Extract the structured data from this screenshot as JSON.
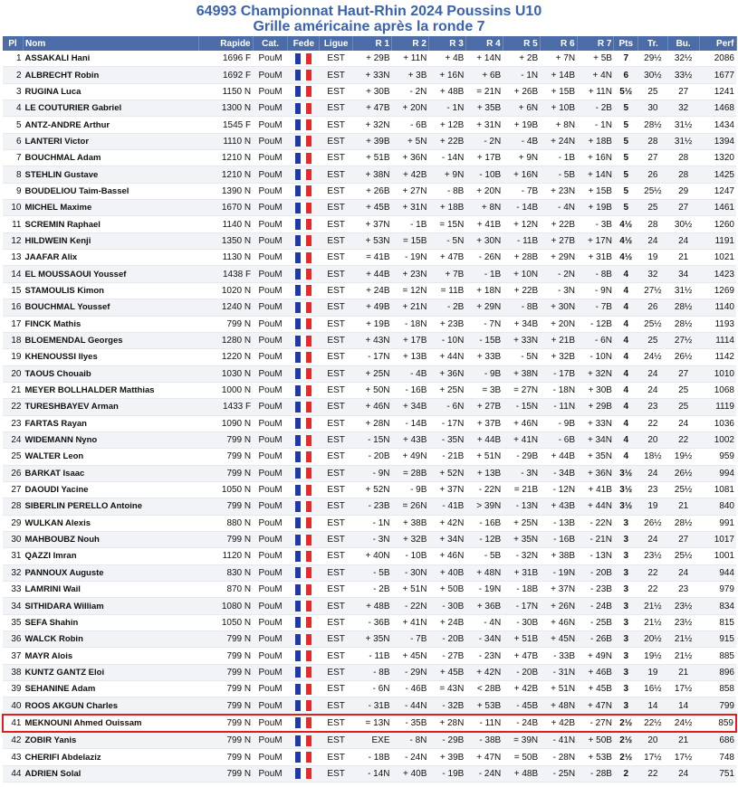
{
  "header": {
    "title": "64993 Championnat Haut-Rhin 2024 Poussins U10",
    "subtitle": "Grille américaine après la ronde 7"
  },
  "columns": [
    "Pl",
    "Nom",
    "Rapide",
    "Cat.",
    "Fede",
    "Ligue",
    "R 1",
    "R 2",
    "R 3",
    "R 4",
    "R 5",
    "R 6",
    "R 7",
    "Pts",
    "Tr.",
    "Bu.",
    "Perf"
  ],
  "highlight_row": 41,
  "colors": {
    "header_bg": "#4b6ca6",
    "title": "#3a62ad",
    "highlight_border": "#e01e1e",
    "flag": [
      "#1f3aa8",
      "#ffffff",
      "#e32b2b"
    ]
  },
  "rows": [
    {
      "pl": "1",
      "nom": "ASSAKALI Hani",
      "rapide": "1696 F",
      "cat": "PouM",
      "fede": "FRA",
      "ligue": "EST",
      "r1": "+ 29B",
      "r2": "+ 11N",
      "r3": "+ 4B",
      "r4": "+ 14N",
      "r5": "+ 2B",
      "r6": "+ 7N",
      "r7": "+ 5B",
      "pts": "7",
      "tr": "29½",
      "bu": "32½",
      "perf": "2086"
    },
    {
      "pl": "2",
      "nom": "ALBRECHT Robin",
      "rapide": "1692 F",
      "cat": "PouM",
      "fede": "FRA",
      "ligue": "EST",
      "r1": "+ 33N",
      "r2": "+ 3B",
      "r3": "+ 16N",
      "r4": "+ 6B",
      "r5": "- 1N",
      "r6": "+ 14B",
      "r7": "+ 4N",
      "pts": "6",
      "tr": "30½",
      "bu": "33½",
      "perf": "1677"
    },
    {
      "pl": "3",
      "nom": "RUGINA Luca",
      "rapide": "1150 N",
      "cat": "PouM",
      "fede": "FRA",
      "ligue": "EST",
      "r1": "+ 30B",
      "r2": "- 2N",
      "r3": "+ 48B",
      "r4": "= 21N",
      "r5": "+ 26B",
      "r6": "+ 15B",
      "r7": "+ 11N",
      "pts": "5½",
      "tr": "25",
      "bu": "27",
      "perf": "1241"
    },
    {
      "pl": "4",
      "nom": "LE COUTURIER Gabriel",
      "rapide": "1300 N",
      "cat": "PouM",
      "fede": "FRA",
      "ligue": "EST",
      "r1": "+ 47B",
      "r2": "+ 20N",
      "r3": "- 1N",
      "r4": "+ 35B",
      "r5": "+ 6N",
      "r6": "+ 10B",
      "r7": "- 2B",
      "pts": "5",
      "tr": "30",
      "bu": "32",
      "perf": "1468"
    },
    {
      "pl": "5",
      "nom": "ANTZ-ANDRE Arthur",
      "rapide": "1545 F",
      "cat": "PouM",
      "fede": "FRA",
      "ligue": "EST",
      "r1": "+ 32N",
      "r2": "- 6B",
      "r3": "+ 12B",
      "r4": "+ 31N",
      "r5": "+ 19B",
      "r6": "+ 8N",
      "r7": "- 1N",
      "pts": "5",
      "tr": "28½",
      "bu": "31½",
      "perf": "1434"
    },
    {
      "pl": "6",
      "nom": "LANTERI Victor",
      "rapide": "1110 N",
      "cat": "PouM",
      "fede": "FRA",
      "ligue": "EST",
      "r1": "+ 39B",
      "r2": "+ 5N",
      "r3": "+ 22B",
      "r4": "- 2N",
      "r5": "- 4B",
      "r6": "+ 24N",
      "r7": "+ 18B",
      "pts": "5",
      "tr": "28",
      "bu": "31½",
      "perf": "1394"
    },
    {
      "pl": "7",
      "nom": "BOUCHMAL Adam",
      "rapide": "1210 N",
      "cat": "PouM",
      "fede": "FRA",
      "ligue": "EST",
      "r1": "+ 51B",
      "r2": "+ 36N",
      "r3": "- 14N",
      "r4": "+ 17B",
      "r5": "+ 9N",
      "r6": "- 1B",
      "r7": "+ 16N",
      "pts": "5",
      "tr": "27",
      "bu": "28",
      "perf": "1320"
    },
    {
      "pl": "8",
      "nom": "STEHLIN Gustave",
      "rapide": "1210 N",
      "cat": "PouM",
      "fede": "FRA",
      "ligue": "EST",
      "r1": "+ 38N",
      "r2": "+ 42B",
      "r3": "+ 9N",
      "r4": "- 10B",
      "r5": "+ 16N",
      "r6": "- 5B",
      "r7": "+ 14N",
      "pts": "5",
      "tr": "26",
      "bu": "28",
      "perf": "1425"
    },
    {
      "pl": "9",
      "nom": "BOUDELIOU Taim-Bassel",
      "rapide": "1390 N",
      "cat": "PouM",
      "fede": "FRA",
      "ligue": "EST",
      "r1": "+ 26B",
      "r2": "+ 27N",
      "r3": "- 8B",
      "r4": "+ 20N",
      "r5": "- 7B",
      "r6": "+ 23N",
      "r7": "+ 15B",
      "pts": "5",
      "tr": "25½",
      "bu": "29",
      "perf": "1247"
    },
    {
      "pl": "10",
      "nom": "MICHEL Maxime",
      "rapide": "1670 N",
      "cat": "PouM",
      "fede": "FRA",
      "ligue": "EST",
      "r1": "+ 45B",
      "r2": "+ 31N",
      "r3": "+ 18B",
      "r4": "+ 8N",
      "r5": "- 14B",
      "r6": "- 4N",
      "r7": "+ 19B",
      "pts": "5",
      "tr": "25",
      "bu": "27",
      "perf": "1461"
    },
    {
      "pl": "11",
      "nom": "SCREMIN Raphael",
      "rapide": "1140 N",
      "cat": "PouM",
      "fede": "FRA",
      "ligue": "EST",
      "r1": "+ 37N",
      "r2": "- 1B",
      "r3": "= 15N",
      "r4": "+ 41B",
      "r5": "+ 12N",
      "r6": "+ 22B",
      "r7": "- 3B",
      "pts": "4½",
      "tr": "28",
      "bu": "30½",
      "perf": "1260"
    },
    {
      "pl": "12",
      "nom": "HILDWEIN Kenji",
      "rapide": "1350 N",
      "cat": "PouM",
      "fede": "FRA",
      "ligue": "EST",
      "r1": "+ 53N",
      "r2": "= 15B",
      "r3": "- 5N",
      "r4": "+ 30N",
      "r5": "- 11B",
      "r6": "+ 27B",
      "r7": "+ 17N",
      "pts": "4½",
      "tr": "24",
      "bu": "24",
      "perf": "1191"
    },
    {
      "pl": "13",
      "nom": "JAAFAR Alix",
      "rapide": "1130 N",
      "cat": "PouM",
      "fede": "FRA",
      "ligue": "EST",
      "r1": "= 41B",
      "r2": "- 19N",
      "r3": "+ 47B",
      "r4": "- 26N",
      "r5": "+ 28B",
      "r6": "+ 29N",
      "r7": "+ 31B",
      "pts": "4½",
      "tr": "19",
      "bu": "21",
      "perf": "1021"
    },
    {
      "pl": "14",
      "nom": "EL MOUSSAOUI Youssef",
      "rapide": "1438 F",
      "cat": "PouM",
      "fede": "FRA",
      "ligue": "EST",
      "r1": "+ 44B",
      "r2": "+ 23N",
      "r3": "+ 7B",
      "r4": "- 1B",
      "r5": "+ 10N",
      "r6": "- 2N",
      "r7": "- 8B",
      "pts": "4",
      "tr": "32",
      "bu": "34",
      "perf": "1423"
    },
    {
      "pl": "15",
      "nom": "STAMOULIS Kimon",
      "rapide": "1020 N",
      "cat": "PouM",
      "fede": "FRA",
      "ligue": "EST",
      "r1": "+ 24B",
      "r2": "= 12N",
      "r3": "= 11B",
      "r4": "+ 18N",
      "r5": "+ 22B",
      "r6": "- 3N",
      "r7": "- 9N",
      "pts": "4",
      "tr": "27½",
      "bu": "31½",
      "perf": "1269"
    },
    {
      "pl": "16",
      "nom": "BOUCHMAL Youssef",
      "rapide": "1240 N",
      "cat": "PouM",
      "fede": "FRA",
      "ligue": "EST",
      "r1": "+ 49B",
      "r2": "+ 21N",
      "r3": "- 2B",
      "r4": "+ 29N",
      "r5": "- 8B",
      "r6": "+ 30N",
      "r7": "- 7B",
      "pts": "4",
      "tr": "26",
      "bu": "28½",
      "perf": "1140"
    },
    {
      "pl": "17",
      "nom": "FINCK Mathis",
      "rapide": "799 N",
      "cat": "PouM",
      "fede": "FRA",
      "ligue": "EST",
      "r1": "+ 19B",
      "r2": "- 18N",
      "r3": "+ 23B",
      "r4": "- 7N",
      "r5": "+ 34B",
      "r6": "+ 20N",
      "r7": "- 12B",
      "pts": "4",
      "tr": "25½",
      "bu": "28½",
      "perf": "1193"
    },
    {
      "pl": "18",
      "nom": "BLOEMENDAL Georges",
      "rapide": "1280 N",
      "cat": "PouM",
      "fede": "FRA",
      "ligue": "EST",
      "r1": "+ 43N",
      "r2": "+ 17B",
      "r3": "- 10N",
      "r4": "- 15B",
      "r5": "+ 33N",
      "r6": "+ 21B",
      "r7": "- 6N",
      "pts": "4",
      "tr": "25",
      "bu": "27½",
      "perf": "1114"
    },
    {
      "pl": "19",
      "nom": "KHENOUSSI Ilyes",
      "rapide": "1220 N",
      "cat": "PouM",
      "fede": "FRA",
      "ligue": "EST",
      "r1": "- 17N",
      "r2": "+ 13B",
      "r3": "+ 44N",
      "r4": "+ 33B",
      "r5": "- 5N",
      "r6": "+ 32B",
      "r7": "- 10N",
      "pts": "4",
      "tr": "24½",
      "bu": "26½",
      "perf": "1142"
    },
    {
      "pl": "20",
      "nom": "TAOUS Chouaib",
      "rapide": "1030 N",
      "cat": "PouM",
      "fede": "FRA",
      "ligue": "EST",
      "r1": "+ 25N",
      "r2": "- 4B",
      "r3": "+ 36N",
      "r4": "- 9B",
      "r5": "+ 38N",
      "r6": "- 17B",
      "r7": "+ 32N",
      "pts": "4",
      "tr": "24",
      "bu": "27",
      "perf": "1010"
    },
    {
      "pl": "21",
      "nom": "MEYER BOLLHALDER Matthias",
      "rapide": "1000 N",
      "cat": "PouM",
      "fede": "FRA",
      "ligue": "EST",
      "r1": "+ 50N",
      "r2": "- 16B",
      "r3": "+ 25N",
      "r4": "= 3B",
      "r5": "= 27N",
      "r6": "- 18N",
      "r7": "+ 30B",
      "pts": "4",
      "tr": "24",
      "bu": "25",
      "perf": "1068"
    },
    {
      "pl": "22",
      "nom": "TURESHBAYEV Arman",
      "rapide": "1433 F",
      "cat": "PouM",
      "fede": "FRA",
      "ligue": "EST",
      "r1": "+ 46N",
      "r2": "+ 34B",
      "r3": "- 6N",
      "r4": "+ 27B",
      "r5": "- 15N",
      "r6": "- 11N",
      "r7": "+ 29B",
      "pts": "4",
      "tr": "23",
      "bu": "25",
      "perf": "1119"
    },
    {
      "pl": "23",
      "nom": "FARTAS Rayan",
      "rapide": "1090 N",
      "cat": "PouM",
      "fede": "FRA",
      "ligue": "EST",
      "r1": "+ 28N",
      "r2": "- 14B",
      "r3": "- 17N",
      "r4": "+ 37B",
      "r5": "+ 46N",
      "r6": "- 9B",
      "r7": "+ 33N",
      "pts": "4",
      "tr": "22",
      "bu": "24",
      "perf": "1036"
    },
    {
      "pl": "24",
      "nom": "WIDEMANN Nyno",
      "rapide": "799 N",
      "cat": "PouM",
      "fede": "FRA",
      "ligue": "EST",
      "r1": "- 15N",
      "r2": "+ 43B",
      "r3": "- 35N",
      "r4": "+ 44B",
      "r5": "+ 41N",
      "r6": "- 6B",
      "r7": "+ 34N",
      "pts": "4",
      "tr": "20",
      "bu": "22",
      "perf": "1002"
    },
    {
      "pl": "25",
      "nom": "WALTER Leon",
      "rapide": "799 N",
      "cat": "PouM",
      "fede": "FRA",
      "ligue": "EST",
      "r1": "- 20B",
      "r2": "+ 49N",
      "r3": "- 21B",
      "r4": "+ 51N",
      "r5": "- 29B",
      "r6": "+ 44B",
      "r7": "+ 35N",
      "pts": "4",
      "tr": "18½",
      "bu": "19½",
      "perf": "959"
    },
    {
      "pl": "26",
      "nom": "BARKAT Isaac",
      "rapide": "799 N",
      "cat": "PouM",
      "fede": "FRA",
      "ligue": "EST",
      "r1": "- 9N",
      "r2": "= 28B",
      "r3": "+ 52N",
      "r4": "+ 13B",
      "r5": "- 3N",
      "r6": "- 34B",
      "r7": "+ 36N",
      "pts": "3½",
      "tr": "24",
      "bu": "26½",
      "perf": "994"
    },
    {
      "pl": "27",
      "nom": "DAOUDI Yacine",
      "rapide": "1050 N",
      "cat": "PouM",
      "fede": "FRA",
      "ligue": "EST",
      "r1": "+ 52N",
      "r2": "- 9B",
      "r3": "+ 37N",
      "r4": "- 22N",
      "r5": "= 21B",
      "r6": "- 12N",
      "r7": "+ 41B",
      "pts": "3½",
      "tr": "23",
      "bu": "25½",
      "perf": "1081"
    },
    {
      "pl": "28",
      "nom": "SIBERLIN PERELLO Antoine",
      "rapide": "799 N",
      "cat": "PouM",
      "fede": "FRA",
      "ligue": "EST",
      "r1": "- 23B",
      "r2": "= 26N",
      "r3": "- 41B",
      "r4": "> 39N",
      "r5": "- 13N",
      "r6": "+ 43B",
      "r7": "+ 44N",
      "pts": "3½",
      "tr": "19",
      "bu": "21",
      "perf": "840"
    },
    {
      "pl": "29",
      "nom": "WULKAN Alexis",
      "rapide": "880 N",
      "cat": "PouM",
      "fede": "FRA",
      "ligue": "EST",
      "r1": "- 1N",
      "r2": "+ 38B",
      "r3": "+ 42N",
      "r4": "- 16B",
      "r5": "+ 25N",
      "r6": "- 13B",
      "r7": "- 22N",
      "pts": "3",
      "tr": "26½",
      "bu": "28½",
      "perf": "991"
    },
    {
      "pl": "30",
      "nom": "MAHBOUBZ Nouh",
      "rapide": "799 N",
      "cat": "PouM",
      "fede": "FRA",
      "ligue": "EST",
      "r1": "- 3N",
      "r2": "+ 32B",
      "r3": "+ 34N",
      "r4": "- 12B",
      "r5": "+ 35N",
      "r6": "- 16B",
      "r7": "- 21N",
      "pts": "3",
      "tr": "24",
      "bu": "27",
      "perf": "1017"
    },
    {
      "pl": "31",
      "nom": "QAZZI Imran",
      "rapide": "1120 N",
      "cat": "PouM",
      "fede": "FRA",
      "ligue": "EST",
      "r1": "+ 40N",
      "r2": "- 10B",
      "r3": "+ 46N",
      "r4": "- 5B",
      "r5": "- 32N",
      "r6": "+ 38B",
      "r7": "- 13N",
      "pts": "3",
      "tr": "23½",
      "bu": "25½",
      "perf": "1001"
    },
    {
      "pl": "32",
      "nom": "PANNOUX Auguste",
      "rapide": "830 N",
      "cat": "PouM",
      "fede": "FRA",
      "ligue": "EST",
      "r1": "- 5B",
      "r2": "- 30N",
      "r3": "+ 40B",
      "r4": "+ 48N",
      "r5": "+ 31B",
      "r6": "- 19N",
      "r7": "- 20B",
      "pts": "3",
      "tr": "22",
      "bu": "24",
      "perf": "944"
    },
    {
      "pl": "33",
      "nom": "LAMRINI Wail",
      "rapide": "870 N",
      "cat": "PouM",
      "fede": "FRA",
      "ligue": "EST",
      "r1": "- 2B",
      "r2": "+ 51N",
      "r3": "+ 50B",
      "r4": "- 19N",
      "r5": "- 18B",
      "r6": "+ 37N",
      "r7": "- 23B",
      "pts": "3",
      "tr": "22",
      "bu": "23",
      "perf": "979"
    },
    {
      "pl": "34",
      "nom": "SITHIDARA William",
      "rapide": "1080 N",
      "cat": "PouM",
      "fede": "FRA",
      "ligue": "EST",
      "r1": "+ 48B",
      "r2": "- 22N",
      "r3": "- 30B",
      "r4": "+ 36B",
      "r5": "- 17N",
      "r6": "+ 26N",
      "r7": "- 24B",
      "pts": "3",
      "tr": "21½",
      "bu": "23½",
      "perf": "834"
    },
    {
      "pl": "35",
      "nom": "SEFA Shahin",
      "rapide": "1050 N",
      "cat": "PouM",
      "fede": "FRA",
      "ligue": "EST",
      "r1": "- 36B",
      "r2": "+ 41N",
      "r3": "+ 24B",
      "r4": "- 4N",
      "r5": "- 30B",
      "r6": "+ 46N",
      "r7": "- 25B",
      "pts": "3",
      "tr": "21½",
      "bu": "23½",
      "perf": "815"
    },
    {
      "pl": "36",
      "nom": "WALCK Robin",
      "rapide": "799 N",
      "cat": "PouM",
      "fede": "FRA",
      "ligue": "EST",
      "r1": "+ 35N",
      "r2": "- 7B",
      "r3": "- 20B",
      "r4": "- 34N",
      "r5": "+ 51B",
      "r6": "+ 45N",
      "r7": "- 26B",
      "pts": "3",
      "tr": "20½",
      "bu": "21½",
      "perf": "915"
    },
    {
      "pl": "37",
      "nom": "MAYR Alois",
      "rapide": "799 N",
      "cat": "PouM",
      "fede": "FRA",
      "ligue": "EST",
      "r1": "- 11B",
      "r2": "+ 45N",
      "r3": "- 27B",
      "r4": "- 23N",
      "r5": "+ 47B",
      "r6": "- 33B",
      "r7": "+ 49N",
      "pts": "3",
      "tr": "19½",
      "bu": "21½",
      "perf": "885"
    },
    {
      "pl": "38",
      "nom": "KUNTZ GANTZ Eloi",
      "rapide": "799 N",
      "cat": "PouM",
      "fede": "FRA",
      "ligue": "EST",
      "r1": "- 8B",
      "r2": "- 29N",
      "r3": "+ 45B",
      "r4": "+ 42N",
      "r5": "- 20B",
      "r6": "- 31N",
      "r7": "+ 46B",
      "pts": "3",
      "tr": "19",
      "bu": "21",
      "perf": "896"
    },
    {
      "pl": "39",
      "nom": "SEHANINE Adam",
      "rapide": "799 N",
      "cat": "PouM",
      "fede": "FRA",
      "ligue": "EST",
      "r1": "- 6N",
      "r2": "- 46B",
      "r3": "= 43N",
      "r4": "< 28B",
      "r5": "+ 42B",
      "r6": "+ 51N",
      "r7": "+ 45B",
      "pts": "3",
      "tr": "16½",
      "bu": "17½",
      "perf": "858"
    },
    {
      "pl": "40",
      "nom": "ROOS AKGUN Charles",
      "rapide": "799 N",
      "cat": "PouM",
      "fede": "FRA",
      "ligue": "EST",
      "r1": "- 31B",
      "r2": "- 44N",
      "r3": "- 32B",
      "r4": "+ 53B",
      "r5": "- 45B",
      "r6": "+ 48N",
      "r7": "+ 47N",
      "pts": "3",
      "tr": "14",
      "bu": "14",
      "perf": "799"
    },
    {
      "pl": "41",
      "nom": "MEKNOUNI Ahmed Ouissam",
      "rapide": "799 N",
      "cat": "PouM",
      "fede": "FRA",
      "ligue": "EST",
      "r1": "= 13N",
      "r2": "- 35B",
      "r3": "+ 28N",
      "r4": "- 11N",
      "r5": "- 24B",
      "r6": "+ 42B",
      "r7": "- 27N",
      "pts": "2½",
      "tr": "22½",
      "bu": "24½",
      "perf": "859"
    },
    {
      "pl": "42",
      "nom": "ZOBIR Yanis",
      "rapide": "799 N",
      "cat": "PouM",
      "fede": "FRA",
      "ligue": "EST",
      "r1": "EXE",
      "r2": "- 8N",
      "r3": "- 29B",
      "r4": "- 38B",
      "r5": "= 39N",
      "r6": "- 41N",
      "r7": "+ 50B",
      "pts": "2½",
      "tr": "20",
      "bu": "21",
      "perf": "686"
    },
    {
      "pl": "43",
      "nom": "CHERIFI Abdelaziz",
      "rapide": "799 N",
      "cat": "PouM",
      "fede": "FRA",
      "ligue": "EST",
      "r1": "- 18B",
      "r2": "- 24N",
      "r3": "+ 39B",
      "r4": "+ 47N",
      "r5": "= 50B",
      "r6": "- 28N",
      "r7": "+ 53B",
      "pts": "2½",
      "tr": "17½",
      "bu": "17½",
      "perf": "748"
    },
    {
      "pl": "44",
      "nom": "ADRIEN Solal",
      "rapide": "799 N",
      "cat": "PouM",
      "fede": "FRA",
      "ligue": "EST",
      "r1": "- 14N",
      "r2": "+ 40B",
      "r3": "- 19B",
      "r4": "- 24N",
      "r5": "+ 48B",
      "r6": "- 25N",
      "r7": "- 28B",
      "pts": "2",
      "tr": "22",
      "bu": "24",
      "perf": "751"
    }
  ]
}
